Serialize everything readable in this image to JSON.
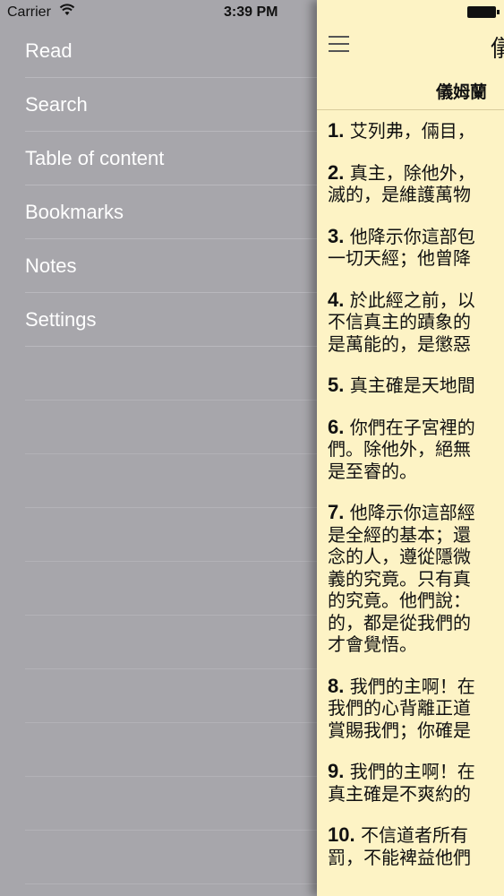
{
  "status_bar": {
    "carrier": "Carrier",
    "time": "3:39 PM"
  },
  "menu": [
    {
      "label": "Read"
    },
    {
      "label": "Search"
    },
    {
      "label": "Table of content"
    },
    {
      "label": "Bookmarks"
    },
    {
      "label": "Notes"
    },
    {
      "label": "Settings"
    }
  ],
  "reader": {
    "title": "儀",
    "subtitle": "儀姆蘭",
    "verses": [
      {
        "num": "1.",
        "lines": [
          "艾列弗，倆目，"
        ]
      },
      {
        "num": "2.",
        "lines": [
          "真主，除他外，",
          "滅的，是維護萬物"
        ]
      },
      {
        "num": "3.",
        "lines": [
          "他降示你這部包",
          "一切天經；他曾降"
        ]
      },
      {
        "num": "4.",
        "lines": [
          "於此經之前，以",
          "不信真主的蹟象的",
          "是萬能的，是懲惡"
        ]
      },
      {
        "num": "5.",
        "lines": [
          "真主確是天地間"
        ]
      },
      {
        "num": "6.",
        "lines": [
          "你們在子宮裡的",
          "們。除他外，絕無",
          "是至睿的。"
        ]
      },
      {
        "num": "7.",
        "lines": [
          "他降示你這部經",
          "是全經的基本；還",
          "念的人，遵從隱微",
          "義的究竟。只有真",
          "的究竟。他們說：",
          "的，都是從我們的",
          "才會覺悟。"
        ]
      },
      {
        "num": "8.",
        "lines": [
          "我們的主啊！在",
          "我們的心背離正道",
          "賞賜我們；你確是"
        ]
      },
      {
        "num": "9.",
        "lines": [
          "我們的主啊！在",
          "真主確是不爽約的"
        ]
      },
      {
        "num": "10.",
        "lines": [
          "不信道者所有",
          "罰，不能裨益他們"
        ]
      }
    ]
  }
}
